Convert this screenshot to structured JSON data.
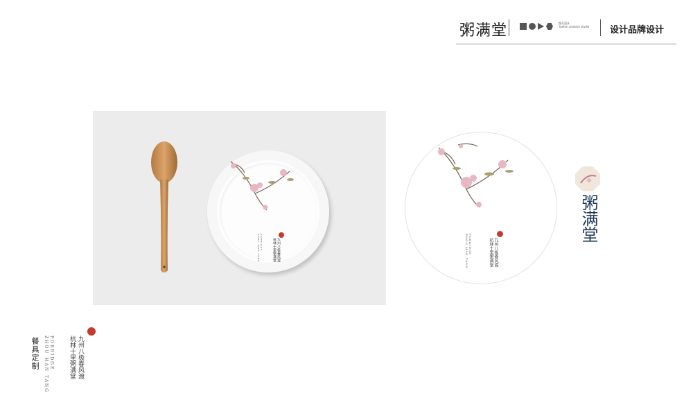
{
  "header": {
    "brand": "粥满堂",
    "tagline_small": [
      "悦凡设计",
      "Yuefan creative studio"
    ],
    "service": "设计品牌设计"
  },
  "poem": {
    "line1": "九州八极春风渡",
    "line2": "杭林十里粥满堂",
    "english_1": "PORRIDGE",
    "english_2": "ZHOU MAN TANG"
  },
  "caption": {
    "title": "餐具定制",
    "poem_line1": "九州八极春风渡",
    "poem_line2": "杭林十里粥满堂",
    "english_1": "PORRIDGE",
    "english_2": "ZHOU MAN TANG"
  },
  "logo": {
    "text": "粥满堂"
  },
  "colors": {
    "accent": "#c43a2e",
    "logo_blue": "#1f3c5a",
    "blossom": "#e7b7c4"
  }
}
